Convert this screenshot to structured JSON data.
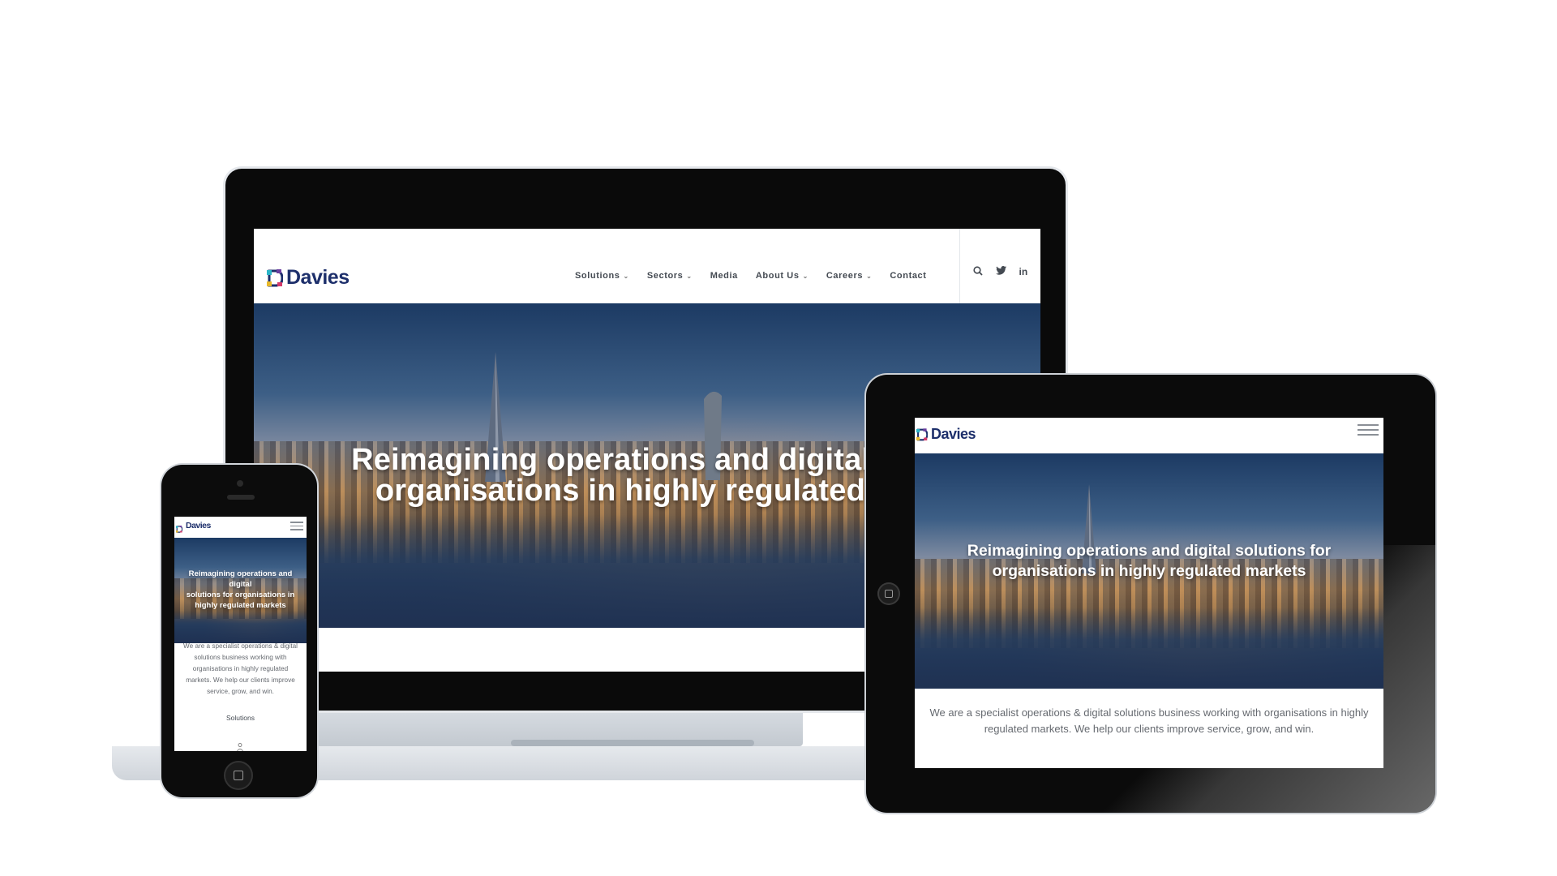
{
  "brand": {
    "name": "Davies",
    "primary_color": "#1d2f6b",
    "logo_colors": [
      "#2bb5c8",
      "#6a3fa0",
      "#e8b92a",
      "#d43a6a"
    ]
  },
  "nav": {
    "items": [
      {
        "label": "Solutions",
        "dropdown": true
      },
      {
        "label": "Sectors",
        "dropdown": true
      },
      {
        "label": "Media",
        "dropdown": false
      },
      {
        "label": "About Us",
        "dropdown": true
      },
      {
        "label": "Careers",
        "dropdown": true
      },
      {
        "label": "Contact",
        "dropdown": false
      }
    ],
    "chevron": "⌄",
    "tools": {
      "search": "⌕",
      "twitter": "𝕥",
      "linkedin": "in"
    }
  },
  "hero": {
    "title_laptop_line1": "Reimagining operations and digital solu",
    "title_laptop_line2": "organisations in highly regulated ma",
    "title_tablet_line1": "Reimagining operations and digital solutions for",
    "title_tablet_line2": "organisations in highly regulated markets",
    "title_phone_line1": "Reimagining operations and digital",
    "title_phone_line2": "solutions for organisations in",
    "title_phone_line3": "highly regulated markets"
  },
  "intro": {
    "tablet_line1": "We are a specialist operations & digital solutions business working with organisations in highly",
    "tablet_line2": "regulated markets. We help our clients improve service, grow, and win.",
    "phone_line1": "We are a specialist operations & digital",
    "phone_line2": "solutions business working with",
    "phone_line3": "organisations in highly regulated",
    "phone_line4": "markets. We help our clients improve",
    "phone_line5": "service, grow, and win."
  },
  "phone_section": {
    "solutions_label": "Solutions"
  }
}
